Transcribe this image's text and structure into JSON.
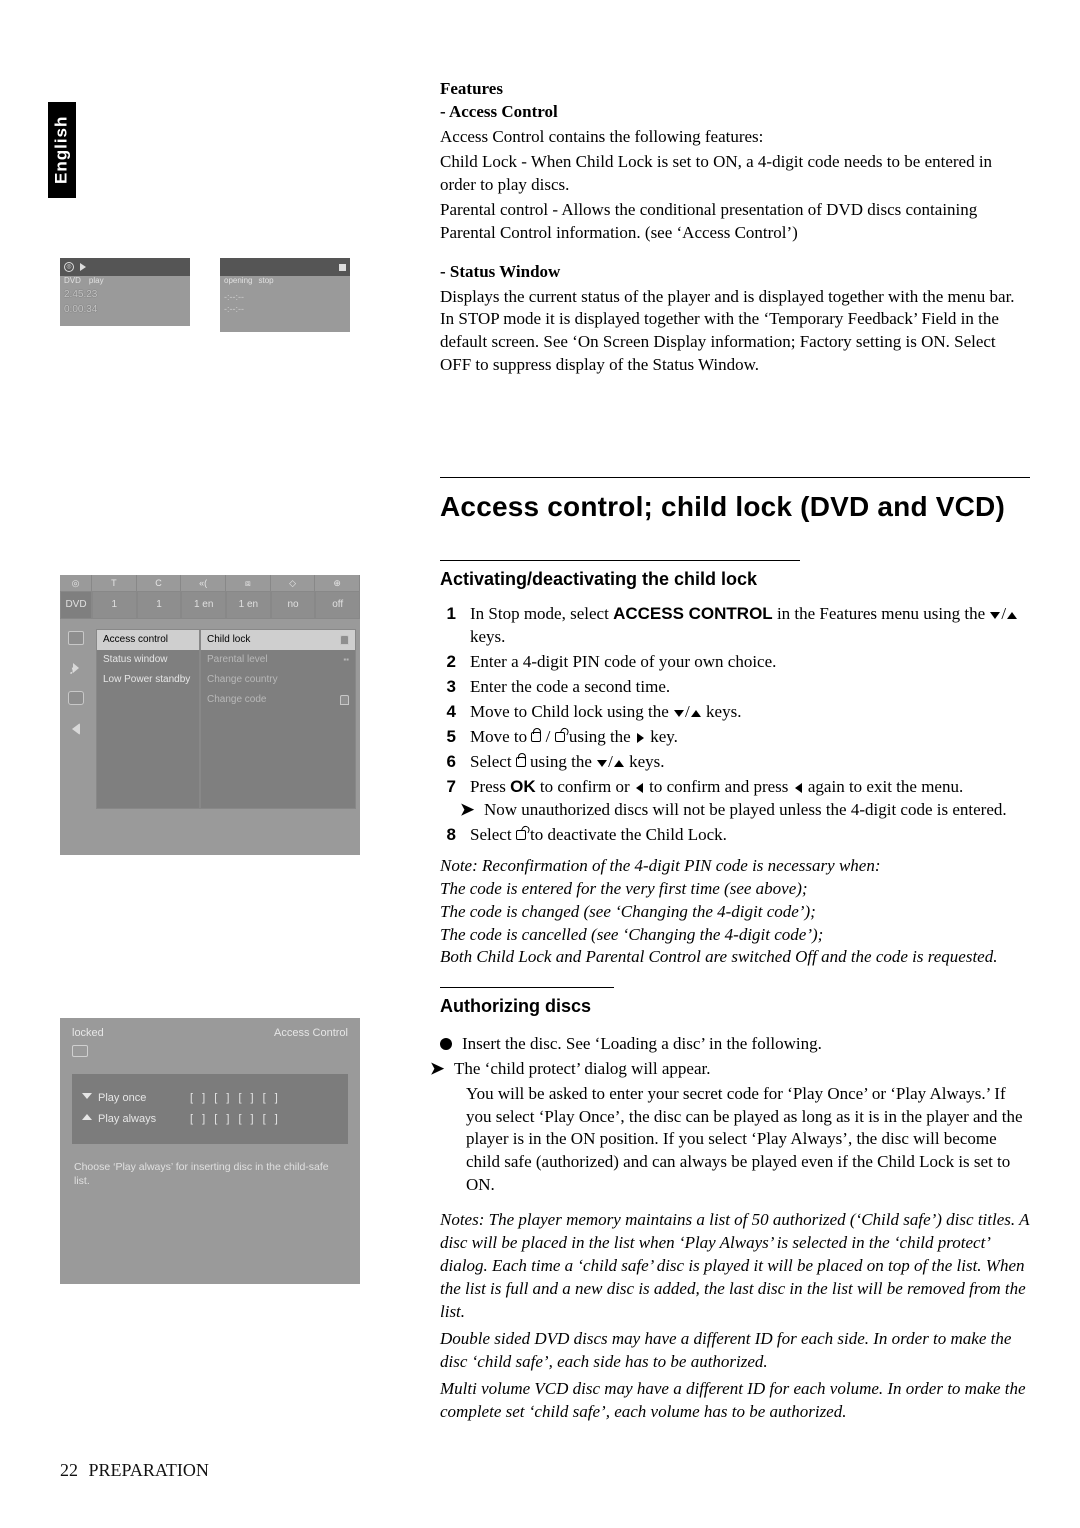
{
  "lang_tab": "English",
  "features": {
    "heading": "Features",
    "access_control_heading": "Access Control",
    "access_control_intro": "Access Control contains the following features:",
    "child_lock_text": "Child Lock - When Child Lock is set to ON, a 4-digit code needs to be entered in order to play discs.",
    "parental_text": "Parental control - Allows the conditional presentation of DVD discs containing Parental Control information. (see ‘Access Control’)",
    "status_heading": "Status Window",
    "status_text": "Displays the current status of the player and is displayed together with the menu bar. In STOP mode it is displayed together with the ‘Temporary Feedback’ Field in the default screen. See ‘On Screen Display information; Factory setting is ON. Select OFF to suppress display of the Status Window."
  },
  "osd_status_left": {
    "label_dvd": "DVD",
    "label_play": "play",
    "time1": "2:45:23",
    "time2": "0:00:34"
  },
  "osd_status_right": {
    "label_opening": "opening",
    "label_stop": "stop",
    "time1": "-:--:--",
    "time2": "-:--:--"
  },
  "osd_menu": {
    "top_vals": [
      "1",
      "1",
      "1 en",
      "1 en",
      "no",
      "off"
    ],
    "top_label_first": "DVD",
    "col1": [
      "Access control",
      "Status window",
      "Low Power standby"
    ],
    "col2": [
      "Child lock",
      "Parental level",
      "Change country",
      "Change code"
    ]
  },
  "osd_auth": {
    "locked": "locked",
    "title_right": "Access Control",
    "play_once": "Play once",
    "play_always": "Play always",
    "boxes": "[ ] [ ] [ ] [ ]",
    "foot": "Choose ‘Play always’ for inserting disc in the child-safe list."
  },
  "h1": "Access control; child lock (DVD and VCD)",
  "activating": {
    "heading": "Activating/deactivating the child lock",
    "steps": [
      {
        "n": "1",
        "pre": "In Stop mode, select ",
        "bold": "ACCESS CONTROL",
        "post": " in the Features menu using the ▼/▲ keys."
      },
      {
        "n": "2",
        "text": "Enter a 4-digit PIN code of your own choice."
      },
      {
        "n": "3",
        "text": "Enter the code a second time."
      },
      {
        "n": "4",
        "pre": "Move to Child lock using the ",
        "keys": "▼/▲",
        "post": " keys."
      },
      {
        "n": "5",
        "pre": "Move to ",
        "lock1": true,
        "mid": " / ",
        "lock2": true,
        "post": " using the ▶ key."
      },
      {
        "n": "6",
        "pre": "Select ",
        "lock1": true,
        "post": " using the ▼/▲ keys."
      },
      {
        "n": "7",
        "pre": "Press ",
        "bold": "OK",
        "post": " to confirm or ◀ to confirm and press ◀ again to exit the menu.",
        "bullet": "Now unauthorized discs will not be played unless the 4-digit code is entered."
      },
      {
        "n": "8",
        "pre": "Select ",
        "lock2": true,
        "post": " to deactivate the Child Lock."
      }
    ],
    "note": "Note: Reconfirmation of the 4-digit PIN code is necessary when:",
    "note_lines": [
      "The code is entered for the very first time (see above);",
      "The code is changed (see ‘Changing the 4-digit code’);",
      "The code is cancelled (see ‘Changing the 4-digit code’);",
      "Both Child Lock and Parental Control are switched Off and the code is requested."
    ]
  },
  "authorizing": {
    "heading": "Authorizing discs",
    "bullet_line": "Insert the disc. See ‘Loading a disc’ in the following.",
    "arrow_line": "The ‘child protect’ dialog will appear.",
    "body": "You will be asked to enter your secret code for ‘Play Once’ or ‘Play Always.’ If you select ‘Play Once’, the disc can be played as long as it is in the player and the player is in the ON position. If you select ‘Play Always’, the disc will become child safe (authorized) and can always be played even if the Child Lock is set to ON.",
    "notes": [
      "Notes: The player memory maintains a list of 50 authorized (‘Child safe’) disc titles. A disc will be placed in the list when ‘Play Always’ is selected in the ‘child protect’ dialog. Each time a ‘child safe’ disc is played it will be placed on top of the list. When the list is full and a new disc is added, the last disc in the list will be removed from the list.",
      "Double sided DVD discs may have a different ID for each side. In order to make the disc ‘child safe’, each side has to be authorized.",
      "Multi volume VCD disc may have a different ID for each volume. In order to make the complete set ‘child safe’, each volume has to be authorized."
    ]
  },
  "footer": {
    "page": "22",
    "section": "PREPARATION"
  }
}
